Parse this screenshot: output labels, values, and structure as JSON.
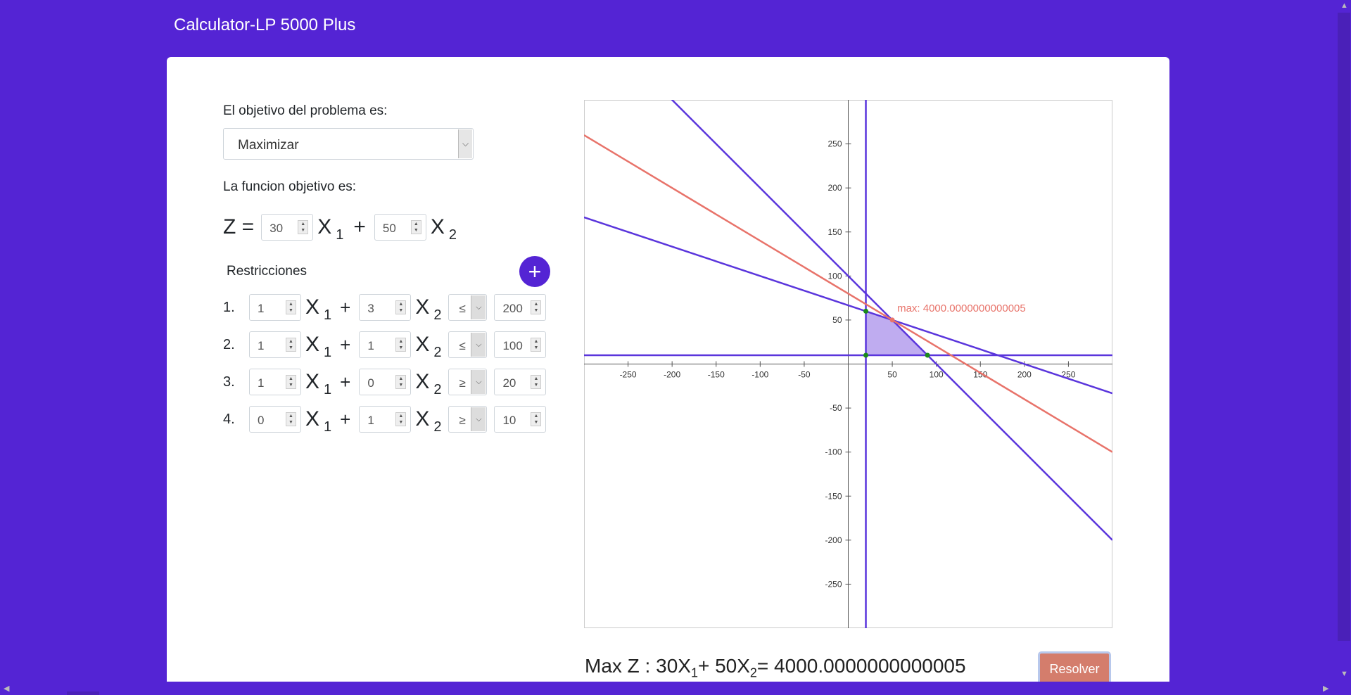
{
  "app": {
    "title": "Calculator-LP 5000 Plus"
  },
  "objective": {
    "label": "El objetivo del problema es:",
    "mode": "Maximizar",
    "function_label": "La funcion objetivo es:",
    "z_label": "Z =",
    "coef1": "30",
    "coef2": "50",
    "var_x": "X",
    "sub1": "1",
    "sub2": "2",
    "plus": "+"
  },
  "restrictions": {
    "title": "Restricciones",
    "add_icon": "plus-icon",
    "items": [
      {
        "index": "1.",
        "a": "1",
        "b": "3",
        "op": "≤",
        "rhs": "200"
      },
      {
        "index": "2.",
        "a": "1",
        "b": "1",
        "op": "≤",
        "rhs": "100"
      },
      {
        "index": "3.",
        "a": "1",
        "b": "0",
        "op": "≥",
        "rhs": "20"
      },
      {
        "index": "4.",
        "a": "0",
        "b": "1",
        "op": "≥",
        "rhs": "10"
      }
    ]
  },
  "graph": {
    "x_ticks": [
      "-250",
      "-200",
      "-150",
      "-100",
      "-50",
      "50",
      "100",
      "150",
      "200",
      "250"
    ],
    "y_ticks": [
      "250",
      "200",
      "150",
      "100",
      "50",
      "-50",
      "-100",
      "-150",
      "-200",
      "-250"
    ],
    "max_label": "max: 4000.0000000000005",
    "colors": {
      "constraint": "#5a35dc",
      "objective": "#e8736a",
      "feasible": "#b8a3ee",
      "vertex": "#1a8a1a"
    }
  },
  "chart_data": {
    "type": "line",
    "x_range": [
      -300,
      300
    ],
    "y_range": [
      -300,
      300
    ],
    "constraints": [
      {
        "a": 1,
        "b": 3,
        "op": "≤",
        "rhs": 200
      },
      {
        "a": 1,
        "b": 1,
        "op": "≤",
        "rhs": 100
      },
      {
        "a": 1,
        "b": 0,
        "op": "≥",
        "rhs": 20
      },
      {
        "a": 0,
        "b": 1,
        "op": "≥",
        "rhs": 10
      }
    ],
    "objective": {
      "c1": 30,
      "c2": 50,
      "value": 4000.0000000000005
    },
    "feasible_polygon": [
      [
        20,
        10
      ],
      [
        20,
        60
      ],
      [
        50,
        50
      ],
      [
        90,
        10
      ]
    ],
    "optimum": [
      50,
      50
    ]
  },
  "result": {
    "prefix": "Max Z : 30X",
    "mid": "+ 50X",
    "suffix": "= 4000.0000000000005",
    "sub1": "1",
    "sub2": "2"
  },
  "buttons": {
    "resolve": "Resolver"
  }
}
